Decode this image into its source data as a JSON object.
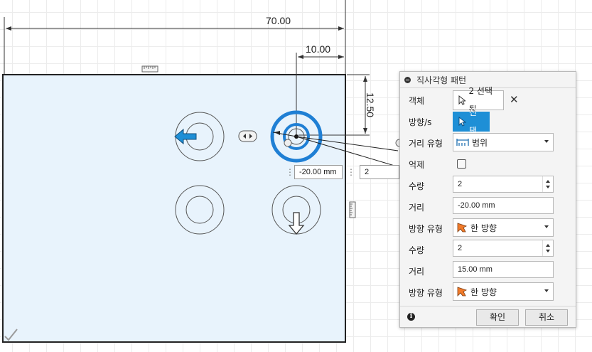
{
  "dimensions": {
    "d_width": "70.00",
    "d_offset": "10.00",
    "d_vertical": "12.50"
  },
  "inline": {
    "distance_value": "-20.00 mm",
    "count_value": "2"
  },
  "panel": {
    "title": "직사각형 패턴",
    "rows": {
      "object_label": "객체",
      "object_value": "2 선택됨",
      "direction_label": "방향/s",
      "direction_value": "선택",
      "distance_type_label": "거리 유형",
      "distance_type_value": "범위",
      "suppress_label": "억제",
      "count1_label": "수량",
      "count1_value": "2",
      "distance1_label": "거리",
      "distance1_value": "-20.00 mm",
      "dirtype1_label": "방향 유형",
      "dirtype1_value": "한 방향",
      "count2_label": "수량",
      "count2_value": "2",
      "distance2_label": "거리",
      "distance2_value": "15.00 mm",
      "dirtype2_label": "방향 유형",
      "dirtype2_value": "한 방향"
    },
    "ok_label": "확인",
    "cancel_label": "취소"
  },
  "colors": {
    "accent": "#1e8fd6",
    "sketch_fill": "#e8f3fc",
    "arrow_blue": "#2b7fd1",
    "arrow_orange": "#f27b2a"
  },
  "icons": [
    "collapse-icon",
    "cursor-icon",
    "close-icon",
    "range-icon",
    "orange-direction-icon",
    "info-icon",
    "arrow-left-icon",
    "arrow-down-icon",
    "dual-arrow-handle-icon",
    "ruler-handle-icon",
    "check-icon"
  ]
}
